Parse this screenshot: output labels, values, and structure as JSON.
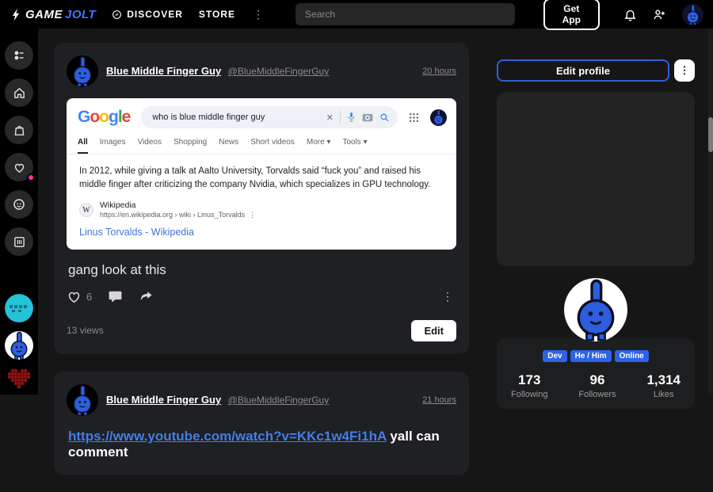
{
  "navbar": {
    "logo_game": "GAME",
    "logo_jolt": "JOLT",
    "discover_label": "DISCOVER",
    "store_label": "STORE",
    "search_placeholder": "Search",
    "get_app_label": "Get App"
  },
  "icons": {
    "kebab": "⋮",
    "close": "✕"
  },
  "posts": [
    {
      "author": "Blue Middle Finger Guy",
      "handle": "@BlueMiddleFingerGuy",
      "time": "20 hours",
      "text": "gang look at this",
      "like_count": "6",
      "views": "13 views",
      "edit_label": "Edit",
      "embed": {
        "logo_letters": [
          "G",
          "o",
          "o",
          "g",
          "l",
          "e"
        ],
        "query": "who is blue middle finger guy",
        "tabs": [
          "All",
          "Images",
          "Videos",
          "Shopping",
          "News",
          "Short videos",
          "More ▾",
          "Tools ▾"
        ],
        "snippet": "In 2012, while giving a talk at Aalto University, Torvalds said “fuck you” and raised his middle finger after criticizing the company Nvidia, which specializes in GPU technology.",
        "favicon_letter": "W",
        "source_name": "Wikipedia",
        "source_url": "https://en.wikipedia.org › wiki › Linus_Torvalds",
        "result_title": "Linus Torvalds - Wikipedia"
      }
    },
    {
      "author": "Blue Middle Finger Guy",
      "handle": "@BlueMiddleFingerGuy",
      "time": "21 hours",
      "link_text": "https://www.youtube.com/watch?v=KKc1w4Fi1hA",
      "after_link_text": "yall can comment"
    }
  ],
  "profile": {
    "edit_profile_label": "Edit profile",
    "badges": [
      "Dev",
      "He / Him",
      "Online"
    ],
    "stats": [
      {
        "value": "173",
        "label": "Following"
      },
      {
        "value": "96",
        "label": "Followers"
      },
      {
        "value": "1,314",
        "label": "Likes"
      }
    ]
  }
}
